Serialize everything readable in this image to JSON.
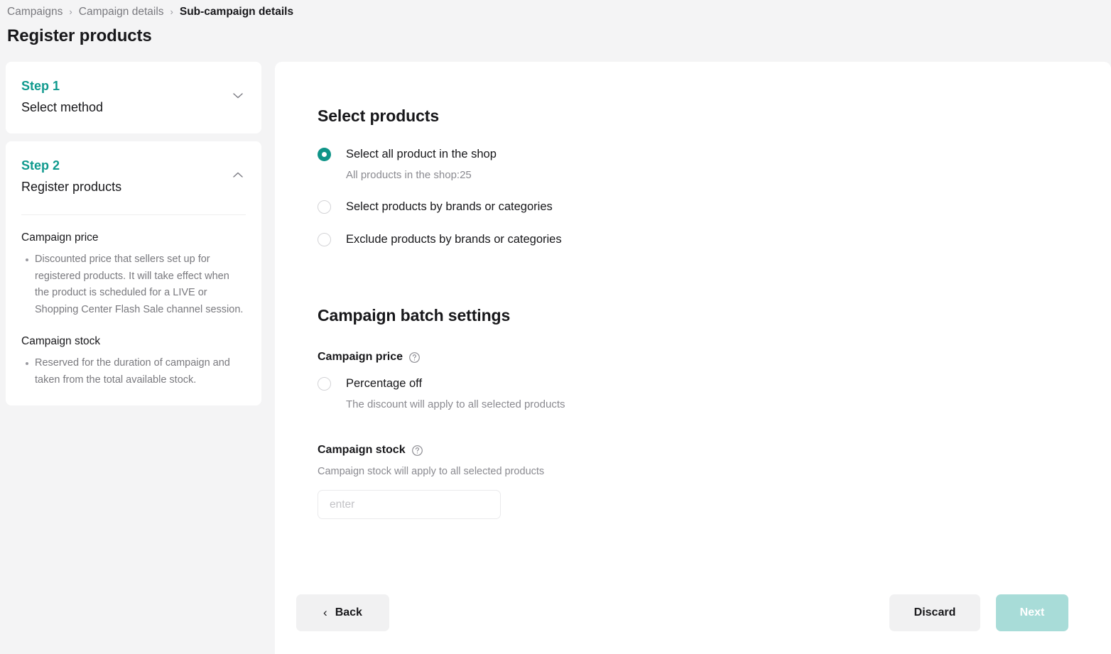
{
  "header": {
    "breadcrumb": [
      {
        "label": "Campaigns",
        "current": false
      },
      {
        "label": "Campaign details",
        "current": false
      },
      {
        "label": "Sub-campaign details",
        "current": true
      }
    ],
    "separator": "›",
    "title": "Register products"
  },
  "sidebar": {
    "steps": [
      {
        "step_label": "Step 1",
        "step_name": "Select method",
        "chevron": "chevron-down-icon",
        "expanded": false
      },
      {
        "step_label": "Step 2",
        "step_name": "Register products",
        "chevron": "chevron-up-icon",
        "expanded": true
      }
    ],
    "info": [
      {
        "title": "Campaign price",
        "bullets": [
          "Discounted price that sellers set up for registered products. It will take effect when the product is scheduled for a LIVE or Shopping Center Flash Sale channel session."
        ]
      },
      {
        "title": "Campaign stock",
        "bullets": [
          "Reserved for the duration of campaign and taken from the total available stock."
        ]
      }
    ]
  },
  "main": {
    "select_products": {
      "title": "Select products",
      "options": [
        {
          "label": "Select all product in the shop",
          "sub": "All products in the shop:25",
          "selected": true
        },
        {
          "label": "Select products by brands or categories",
          "sub": "",
          "selected": false
        },
        {
          "label": "Exclude products by brands or categories",
          "sub": "",
          "selected": false
        }
      ]
    },
    "batch_settings": {
      "title": "Campaign batch settings",
      "campaign_price": {
        "label": "Campaign price",
        "help_icon": "question-circle-icon",
        "option_label": "Percentage off",
        "option_sub": "The discount will apply to all selected products",
        "selected": false
      },
      "campaign_stock": {
        "label": "Campaign stock",
        "help_icon": "question-circle-icon",
        "hint": "Campaign stock will apply to all selected products",
        "input_placeholder": "enter",
        "input_value": ""
      }
    }
  },
  "footer": {
    "back_label": "Back",
    "back_icon": "chevron-left-icon",
    "discard_label": "Discard",
    "next_label": "Next",
    "next_disabled": true
  },
  "colors": {
    "accent_teal": "#0f9488",
    "step_teal": "#109a8e",
    "next_disabled_bg": "#a8dcd8",
    "page_bg": "#f4f4f5",
    "panel_bg": "#ffffff",
    "button_gray": "#f1f1f2"
  }
}
